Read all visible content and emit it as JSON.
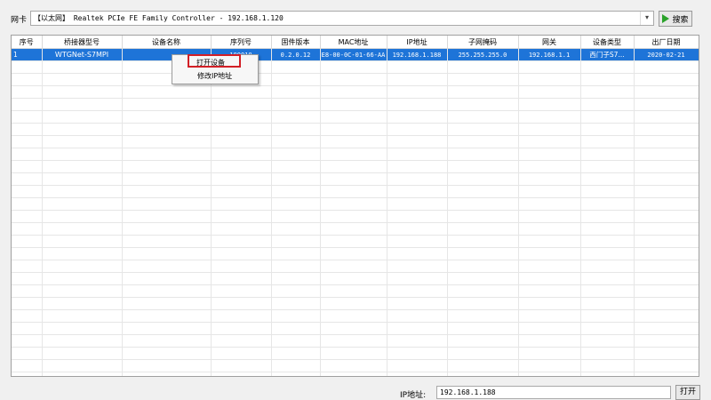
{
  "toolbar": {
    "nic_label": "网卡",
    "nic_value": "【以太网】 Realtek PCIe FE Family Controller - 192.168.1.120",
    "search_label": "搜索",
    "accent_color": "#2aa22a"
  },
  "table": {
    "headers": [
      "序号",
      "桥接器型号",
      "设备名称",
      "序列号",
      "固件版本",
      "MAC地址",
      "IP地址",
      "子网掩码",
      "网关",
      "设备类型",
      "出厂日期"
    ],
    "row": {
      "index": "1",
      "model": "WTGNet-S7MPI",
      "name": "",
      "serial": "100010",
      "firmware": "0.2.0.12",
      "mac": "E8-00-0C-01-66-AA",
      "ip": "192.168.1.188",
      "mask": "255.255.255.0",
      "gateway": "192.168.1.1",
      "type": "西门子S7...",
      "date": "2020-02-21"
    },
    "selected_color": "#1e74d8"
  },
  "context_menu": {
    "open_device": "打开设备",
    "modify_ip": "修改IP地址",
    "highlight_color": "#d21f26"
  },
  "footer": {
    "ip_label": "IP地址:",
    "ip_value": "192.168.1.188",
    "open_label": "打开"
  }
}
